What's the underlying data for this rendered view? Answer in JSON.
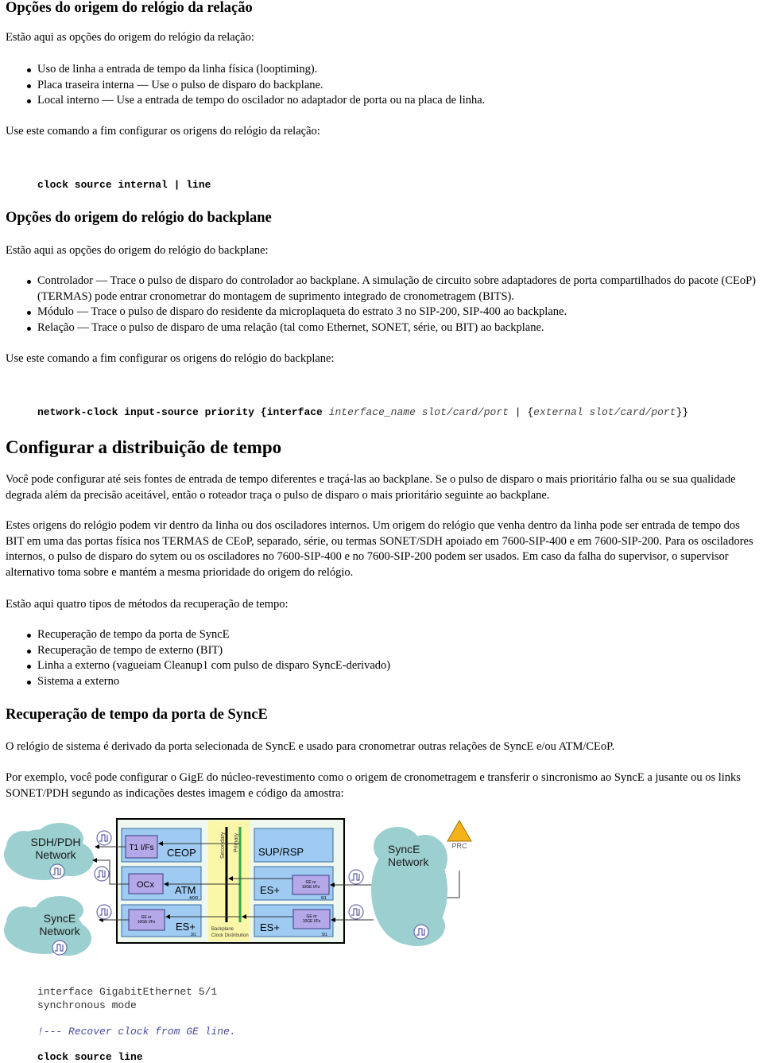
{
  "section1": {
    "heading": "Opções do origem do relógio da relação",
    "intro": "Estão aqui as opções do origem do relógio da relação:",
    "items": [
      "Uso de linha a entrada de tempo da linha física (looptiming).",
      "Placa traseira interna — Use o pulso de disparo do backplane.",
      "Local interno — Use a entrada de tempo do oscilador no adaptador de porta ou na placa de linha."
    ],
    "command_intro": "Use este comando a fim configurar os origens do relógio da relação:",
    "command": "clock source internal | line"
  },
  "section2": {
    "heading": "Opções do origem do relógio do backplane",
    "intro": "Estão aqui as opções do origem do relógio do backplane:",
    "items": [
      "Controlador — Trace o pulso de disparo do controlador ao backplane. A simulação de circuito sobre adaptadores de porta compartilhados do pacote (CEoP) (TERMAS) pode entrar cronometrar do montagem de suprimento integrado de cronometragem (BITS).",
      "Módulo — Trace o pulso de disparo do residente da microplaqueta do estrato 3 no SIP-200, SIP-400 ao backplane.",
      "Relação — Trace o pulso de disparo de uma relação (tal como Ethernet, SONET, série, ou BIT) ao backplane."
    ],
    "command_intro": "Use este comando a fim configurar os origens do relógio do backplane:",
    "command": {
      "bold_part": "network-clock input-source priority {interface ",
      "ital_part1": "interface_name slot/card/port",
      "sep": " | {",
      "ital_part2": "external slot/card/port",
      "end": "}}"
    }
  },
  "section3": {
    "heading": "Configurar a distribuição de tempo",
    "para1": "Você pode configurar até seis fontes de entrada de tempo diferentes e traçá-las ao backplane. Se o pulso de disparo o mais prioritário falha ou se sua qualidade degrada além da precisão aceitável, então o roteador traça o pulso de disparo o mais prioritário seguinte ao backplane.",
    "para2": "Estes origens do relógio podem vir dentro da linha ou dos osciladores internos. Um origem do relógio que venha dentro da linha pode ser entrada de tempo dos BIT em uma das portas física nos TERMAS de CEoP, separado, série, ou termas SONET/SDH apoiado em 7600-SIP-400 e em 7600-SIP-200. Para os osciladores internos, o pulso de disparo do sytem ou os osciladores no 7600-SIP-400 e no 7600-SIP-200 podem ser usados. Em caso da falha do supervisor, o supervisor alternativo toma sobre e mantém a mesma prioridade do origem do relógio.",
    "methods_intro": "Estão aqui quatro tipos de métodos da recuperação de tempo:",
    "methods": [
      "Recuperação de tempo da porta de SyncE",
      "Recuperação de tempo de externo (BIT)",
      "Linha a externo (vagueiam Cleanup1 com pulso de disparo SyncE-derivado)",
      "Sistema a externo"
    ]
  },
  "section4": {
    "heading": "Recuperação de tempo da porta de SyncE",
    "para1": "O relógio de sistema é derivado da porta selecionada de SyncE e usado para cronometrar outras relações de SyncE e/ou ATM/CEoP.",
    "para2": "Por exemplo, você pode configurar o GigE do núcleo-revestimento como o origem de cronometragem e transferir o sincronismo ao SyncE a jusante ou os links SONET/PDH segundo as indicações destes imagem e código da amostra:"
  },
  "diagram": {
    "cloud_sdh": [
      "SDH/PDH",
      "Network"
    ],
    "cloud_synce_left": [
      "SyncE",
      "Network"
    ],
    "cloud_synce_right": [
      "SyncE",
      "Network"
    ],
    "prc": "PRC",
    "cards": {
      "ceop": "CEOP",
      "t1": "T1 I/Fs",
      "atm": "ATM",
      "atm_slot": "4/0/0",
      "ocx": "OCx",
      "es_left": "ES+",
      "es_left_slot": "3/1",
      "ge_if": [
        "GE or",
        "10GE I/Fs"
      ],
      "sup": "SUP/RSP",
      "es_r1": "ES+",
      "es_r1_slot": "6/1",
      "es_r2": "ES+",
      "es_r2_slot": "5/1"
    },
    "bus_secondary": "Secondary",
    "bus_primary": "Primary",
    "backplane_label": [
      "Backplane",
      "Clock Distribution"
    ],
    "colors": {
      "cloud": "#9ccfcf",
      "card": "#9fcbf2",
      "interface": "#b4a8e8",
      "backplane": "#fbf7a8",
      "primary_bus": "#2fa84a",
      "prc": "#f3b21a"
    }
  },
  "sample_code": {
    "line1": "interface GigabitEthernet 5/1",
    "line2": "synchronous mode",
    "comment": "!--- Recover clock from GE line.",
    "line3": "clock source line"
  }
}
